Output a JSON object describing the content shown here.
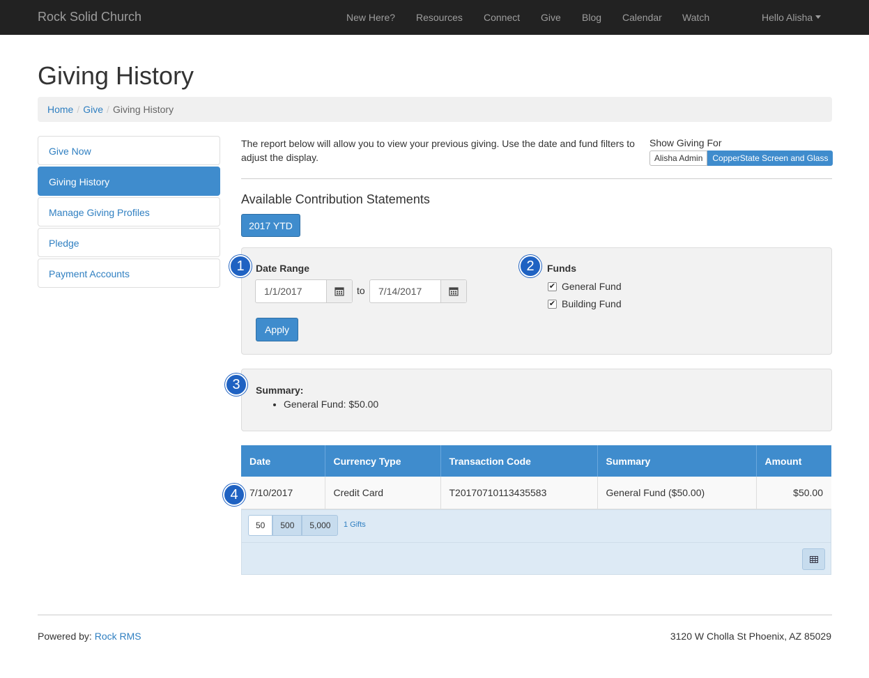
{
  "navbar": {
    "brand": "Rock Solid Church",
    "links": [
      "New Here?",
      "Resources",
      "Connect",
      "Give",
      "Blog",
      "Calendar",
      "Watch"
    ],
    "user_greeting": "Hello Alisha"
  },
  "page": {
    "title": "Giving History"
  },
  "breadcrumb": {
    "home": "Home",
    "give": "Give",
    "current": "Giving History"
  },
  "sidebar": {
    "items": [
      {
        "label": "Give Now"
      },
      {
        "label": "Giving History"
      },
      {
        "label": "Manage Giving Profiles"
      },
      {
        "label": "Pledge"
      },
      {
        "label": "Payment Accounts"
      }
    ]
  },
  "intro": {
    "text": "The report below will allow you to view your previous giving. Use the date and fund filters to adjust the display."
  },
  "show_giving_for": {
    "label": "Show Giving For",
    "options": [
      "Alisha Admin",
      "CopperState Screen and Glass"
    ],
    "selected": "CopperState Screen and Glass"
  },
  "statements": {
    "title": "Available Contribution Statements",
    "button": "2017 YTD"
  },
  "filters": {
    "date_range_label": "Date Range",
    "start_date": "1/1/2017",
    "to_label": "to",
    "end_date": "7/14/2017",
    "apply_label": "Apply",
    "funds_label": "Funds",
    "funds": [
      {
        "name": "General Fund",
        "checked": true
      },
      {
        "name": "Building Fund",
        "checked": true
      }
    ]
  },
  "summary": {
    "title": "Summary:",
    "items": [
      "General Fund: $50.00"
    ]
  },
  "table": {
    "headers": [
      "Date",
      "Currency Type",
      "Transaction Code",
      "Summary",
      "Amount"
    ],
    "rows": [
      [
        "7/10/2017",
        "Credit Card",
        "T20170710113435583",
        "General Fund ($50.00)",
        "$50.00"
      ]
    ]
  },
  "pager": {
    "sizes": [
      "50",
      "500",
      "5,000"
    ],
    "selected": "50",
    "count_label": "1 Gifts"
  },
  "callouts": [
    "1",
    "2",
    "3",
    "4"
  ],
  "footer": {
    "powered_prefix": "Powered by:",
    "powered_link": "Rock RMS",
    "address": "3120 W Cholla St Phoenix, AZ 85029"
  },
  "colors": {
    "primary": "#3f8ccd",
    "navbar": "#222222",
    "callout": "#1f62c2",
    "panel": "#f2f2f2"
  },
  "icons": {
    "calendar": "calendar-icon",
    "export": "excel-export-icon",
    "caret": "caret-down-icon"
  }
}
